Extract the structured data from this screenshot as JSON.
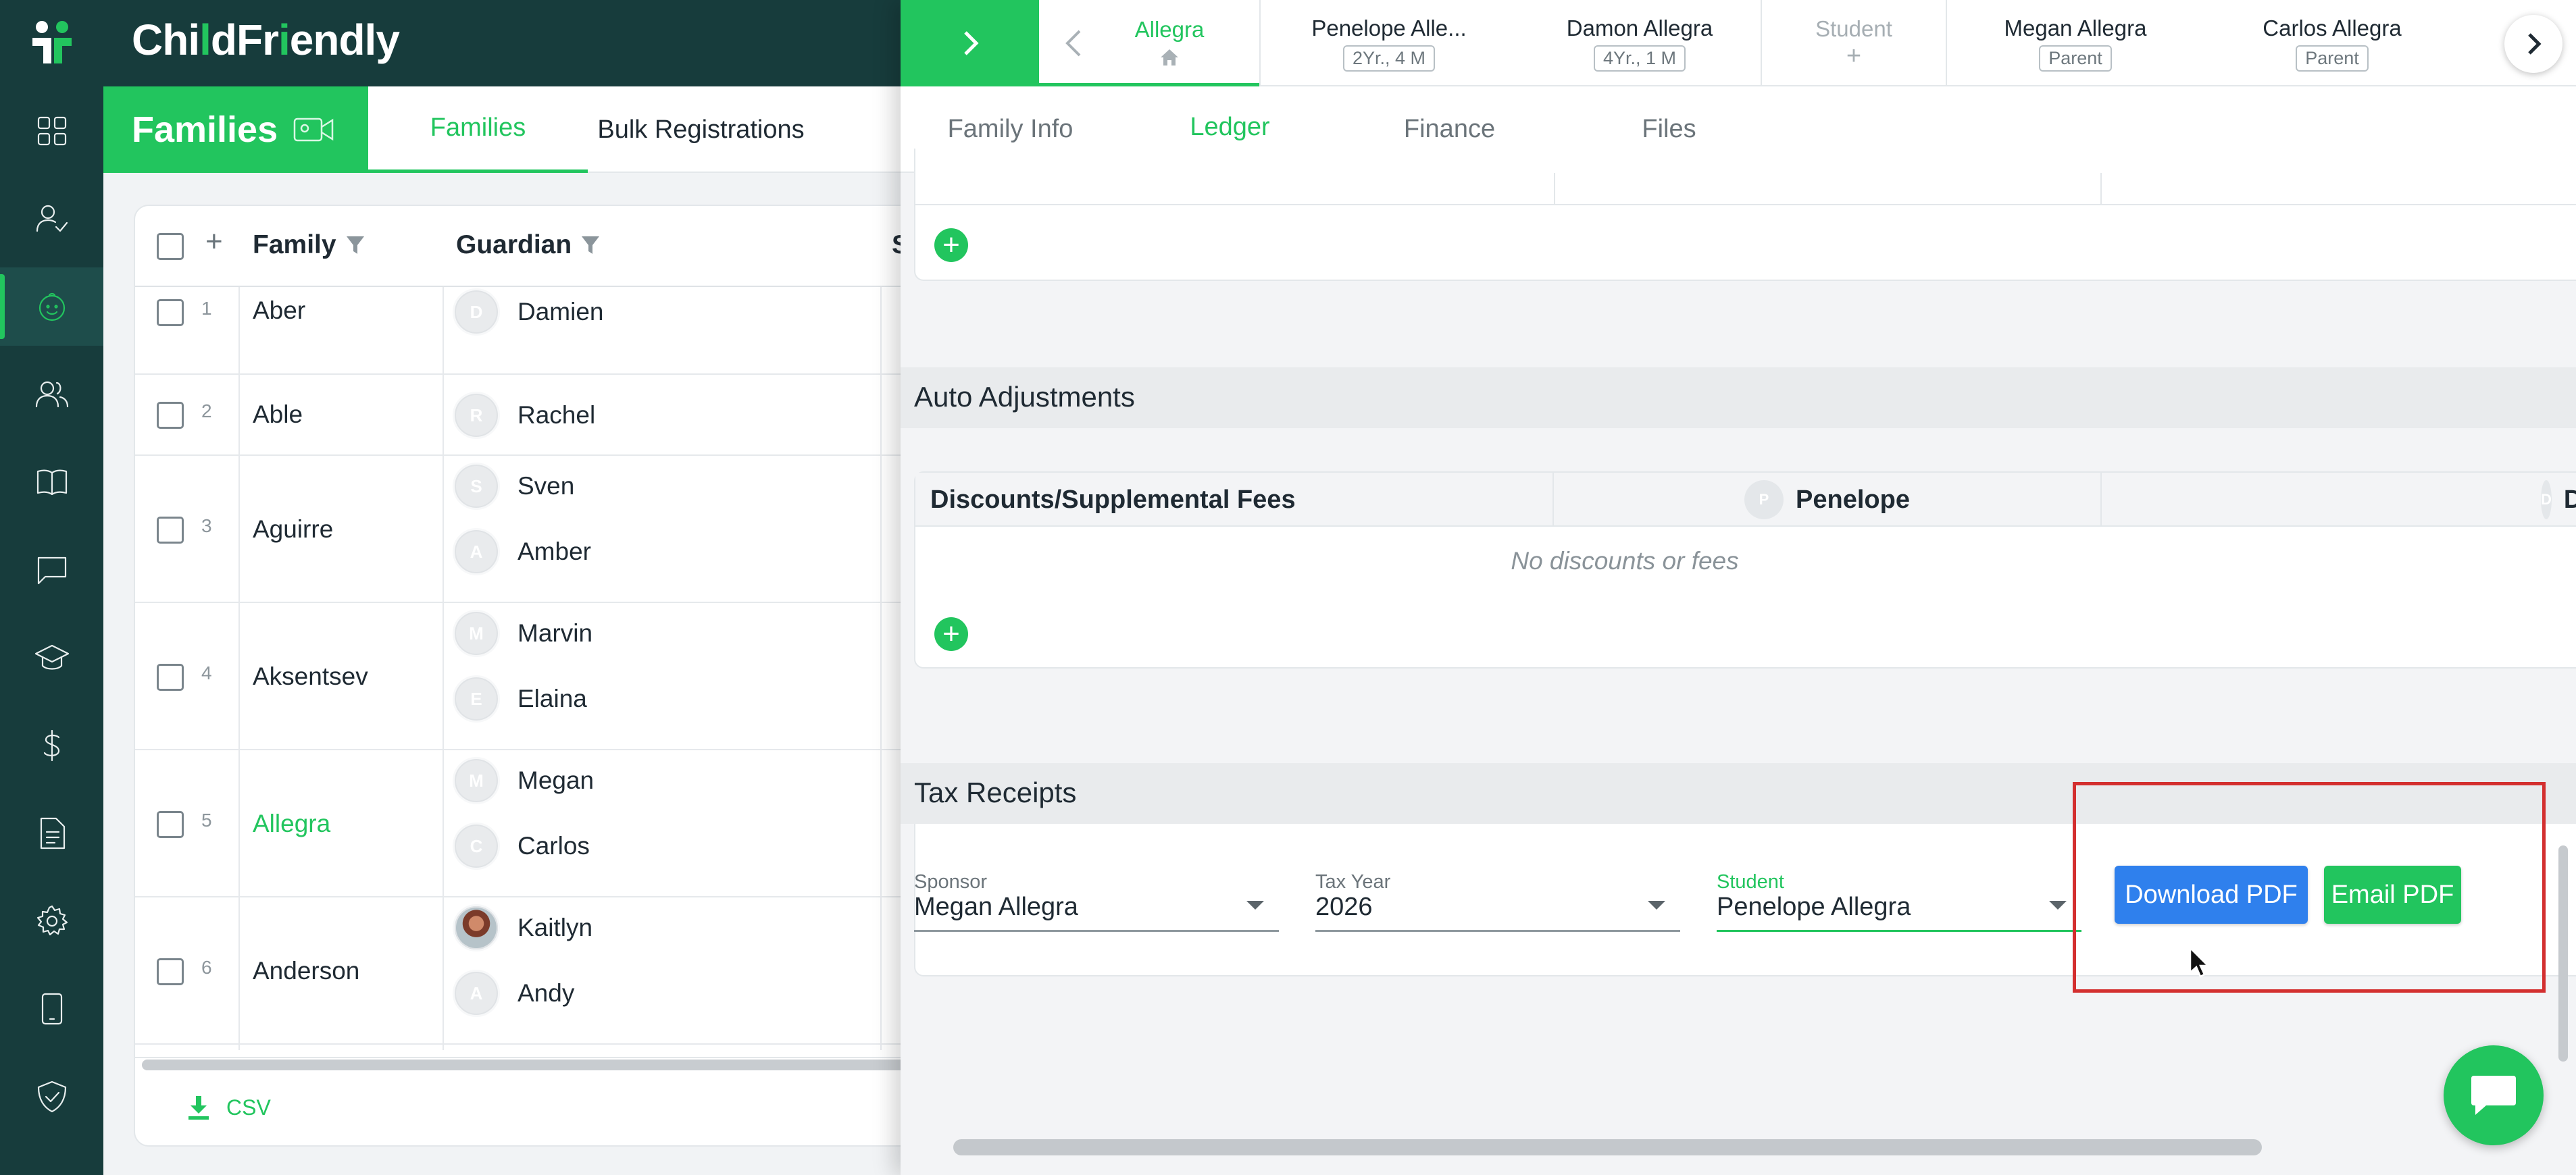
{
  "app": {
    "brand": {
      "part1": "Chi",
      "part2": "l",
      "part3": "d",
      "part4": "Fr",
      "part5": "i",
      "part6": "endly"
    },
    "accent": "#22c55e",
    "nav_dark": "#173c3c"
  },
  "rail": {
    "items": [
      {
        "icon": "dashboard-grid-icon"
      },
      {
        "icon": "attendance-check-icon"
      },
      {
        "icon": "child-face-icon",
        "active": true
      },
      {
        "icon": "people-icon"
      },
      {
        "icon": "book-icon"
      },
      {
        "icon": "chat-icon"
      },
      {
        "icon": "graduation-cap-icon"
      },
      {
        "icon": "dollar-icon"
      },
      {
        "icon": "document-icon"
      },
      {
        "icon": "settings-gear-icon"
      },
      {
        "icon": "tablet-icon"
      },
      {
        "icon": "shield-check-icon"
      }
    ]
  },
  "families_header": {
    "title": "Families",
    "tabs": [
      {
        "label": "Families",
        "active": true
      },
      {
        "label": "Bulk Registrations",
        "active": false
      }
    ]
  },
  "table": {
    "columns": {
      "family": "Family",
      "guardian": "Guardian",
      "third_partial": "S"
    },
    "add_symbol": "+",
    "rows": [
      {
        "num": "1",
        "family": "Aber",
        "guardians": [
          {
            "initial": "D",
            "name": "Damien"
          }
        ]
      },
      {
        "num": "2",
        "family": "Able",
        "guardians": [
          {
            "initial": "R",
            "name": "Rachel"
          }
        ]
      },
      {
        "num": "3",
        "family": "Aguirre",
        "guardians": [
          {
            "initial": "S",
            "name": "Sven"
          },
          {
            "initial": "A",
            "name": "Amber"
          }
        ]
      },
      {
        "num": "4",
        "family": "Aksentsev",
        "guardians": [
          {
            "initial": "M",
            "name": "Marvin"
          },
          {
            "initial": "E",
            "name": "Elaina"
          }
        ]
      },
      {
        "num": "5",
        "family": "Allegra",
        "selected": true,
        "guardians": [
          {
            "initial": "M",
            "name": "Megan"
          },
          {
            "initial": "C",
            "name": "Carlos"
          }
        ]
      },
      {
        "num": "6",
        "family": "Anderson",
        "guardians": [
          {
            "initial": "",
            "name": "Kaitlyn",
            "photo": true
          },
          {
            "initial": "A",
            "name": "Andy"
          }
        ]
      }
    ],
    "csv_label": "CSV"
  },
  "family_panel": {
    "members": [
      {
        "name": "Allegra",
        "badge": "",
        "active": true
      },
      {
        "name": "Penelope Alle...",
        "badge": "2Yr., 4 M"
      },
      {
        "name": "Damon Allegra",
        "badge": "4Yr., 1 M"
      },
      {
        "name": "Student",
        "badge": "+",
        "muted": true
      },
      {
        "name": "Megan Allegra",
        "badge": "Parent"
      },
      {
        "name": "Carlos Allegra",
        "badge": "Parent"
      }
    ],
    "tabs": [
      {
        "label": "Family Info"
      },
      {
        "label": "Ledger",
        "active": true
      },
      {
        "label": "Finance"
      },
      {
        "label": "Files"
      }
    ],
    "auto_adjustments": {
      "title": "Auto Adjustments",
      "columns": [
        {
          "label": "Discounts/Supplemental Fees"
        },
        {
          "label": "Penelope",
          "initial": "P"
        },
        {
          "label": "Damon",
          "initial": "D"
        }
      ],
      "empty_text": "No discounts or fees"
    },
    "tax_receipts": {
      "title": "Tax Receipts",
      "sponsor": {
        "label": "Sponsor",
        "value": "Megan Allegra"
      },
      "tax_year": {
        "label": "Tax Year",
        "value": "2026"
      },
      "student": {
        "label": "Student",
        "value": "Penelope Allegra"
      },
      "download_label": "Download PDF",
      "email_label": "Email PDF",
      "download_color": "#2f80ed",
      "email_color": "#22c55e"
    }
  }
}
